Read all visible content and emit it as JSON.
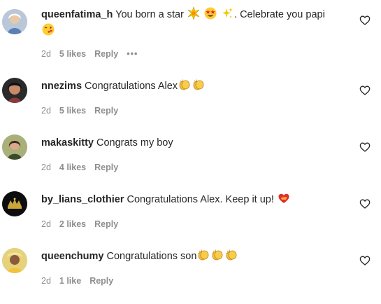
{
  "comments": [
    {
      "username": "queenfatima_h",
      "text_before": " You born a star ",
      "text_after": ". Celebrate you papi",
      "time": "2d",
      "likes": "5 likes",
      "reply": "Reply",
      "more": "•••",
      "emoji_icons": [
        "sparkle-burst-icon",
        "star-struck-face-icon",
        "sparkles-icon",
        "kissing-wink-face-icon"
      ]
    },
    {
      "username": "nnezims",
      "text": " Congratulations Alex",
      "time": "2d",
      "likes": "5 likes",
      "reply": "Reply",
      "emoji_icons": [
        "clapping-hands-icon",
        "clapping-hands-icon"
      ]
    },
    {
      "username": "makaskitty",
      "text": " Congrats my boy",
      "time": "2d",
      "likes": "4 likes",
      "reply": "Reply"
    },
    {
      "username": "by_lians_clothier",
      "text": " Congratulations Alex. Keep it up! ",
      "time": "2d",
      "likes": "2 likes",
      "reply": "Reply",
      "emoji_icons": [
        "heart-on-fire-icon"
      ]
    },
    {
      "username": "queenchumy",
      "text": " Congratulations son",
      "time": "2d",
      "likes": "1 like",
      "reply": "Reply",
      "emoji_icons": [
        "clapping-hands-icon",
        "clapping-hands-icon",
        "clapping-hands-icon"
      ]
    }
  ],
  "colors": {
    "text": "#262626",
    "meta": "#8e8e8e",
    "background": "#ffffff"
  }
}
